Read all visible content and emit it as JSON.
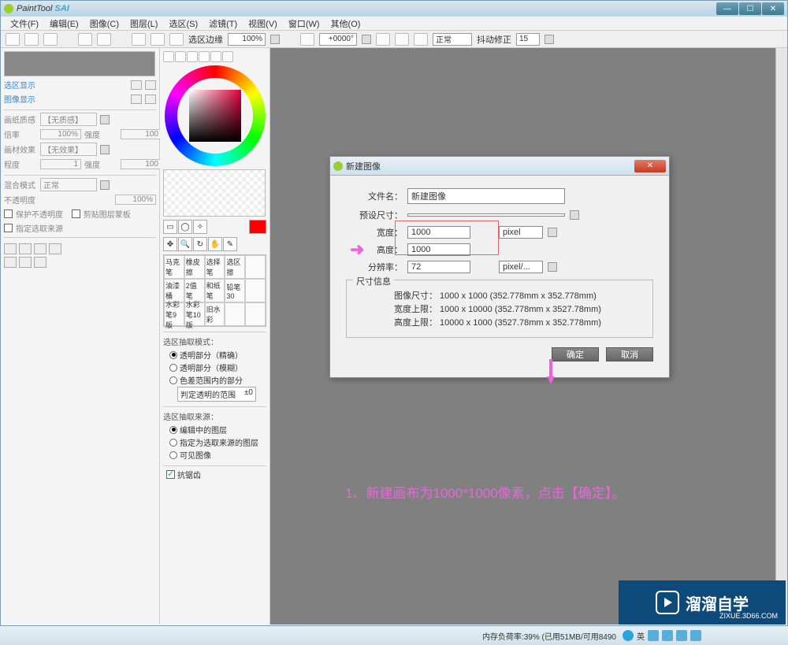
{
  "title": {
    "app": "PaintTool",
    "brand": "SAI"
  },
  "menu": [
    "文件(F)",
    "编辑(E)",
    "图像(C)",
    "图层(L)",
    "选区(S)",
    "滤镜(T)",
    "视图(V)",
    "窗口(W)",
    "其他(O)"
  ],
  "toolbar": {
    "sel_border_label": "选区边缘",
    "sel_border_val": "100%",
    "angle": "+0000°",
    "mode": "正常",
    "stabilizer_label": "抖动修正",
    "stabilizer_val": "15"
  },
  "props": {
    "paper_label": "画纸质感",
    "paper_val": "【无质感】",
    "zoom_label": "倍率",
    "zoom_val": "100%",
    "strength_label": "强度",
    "strength_val": "100",
    "brush_fx_label": "画材效果",
    "brush_fx_val": "【无效果】",
    "degree_label": "程度",
    "degree_val": "1",
    "strength2_val": "100",
    "blend_label": "混合模式",
    "blend_val": "正常",
    "opacity_label": "不透明度",
    "opacity_val": "100%",
    "protect": "保护不透明度",
    "clip": "剪贴图层蒙板",
    "sel_source": "指定选取来源"
  },
  "brushes": [
    "马克笔",
    "橡皮擦",
    "选择笔",
    "选区擦",
    "",
    "油漆桶",
    "2值笔",
    "和纸笔",
    "铅笔30",
    "",
    "水彩笔9版",
    "水彩笔10版",
    "旧水彩",
    "",
    ""
  ],
  "selection": {
    "mode_title": "选区抽取模式：",
    "mode_opt1": "透明部分（精确）",
    "mode_opt2": "透明部分（模糊）",
    "mode_opt3": "色差范围内的部分",
    "judge_label": "判定透明的范围",
    "judge_val": "±0",
    "source_title": "选区抽取来源：",
    "src_opt1": "编辑中的图层",
    "src_opt2": "指定为选取来源的图层",
    "src_opt3": "可见图像",
    "antialias": "抗锯齿"
  },
  "dialog": {
    "title": "新建图像",
    "filename_label": "文件名：",
    "filename_val": "新建图像",
    "preset_label": "预设尺寸：",
    "preset_val": "",
    "width_label": "宽度：",
    "width_val": "1000",
    "height_label": "高度：",
    "height_val": "1000",
    "unit1": "pixel",
    "res_label": "分辨率：",
    "res_val": "72",
    "unit2": "pixel/...",
    "info_title": "尺寸信息",
    "info1": "图像尺寸：  1000 x 1000  (352.778mm x 352.778mm)",
    "info2": "宽度上限：  1000 x 10000 (352.778mm x 3527.78mm)",
    "info3": "高度上限：  10000 x 1000 (3527.78mm x 352.778mm)",
    "ok": "确定",
    "cancel": "取消"
  },
  "annotation": "1、新建画布为1000*1000像素，点击【确定】。",
  "status": "内存负荷率:39% (已用51MB/可用8490",
  "status_ime": "英",
  "watermark": {
    "cn": "溜溜自学",
    "url": "ZIXUE.3D66.COM"
  }
}
